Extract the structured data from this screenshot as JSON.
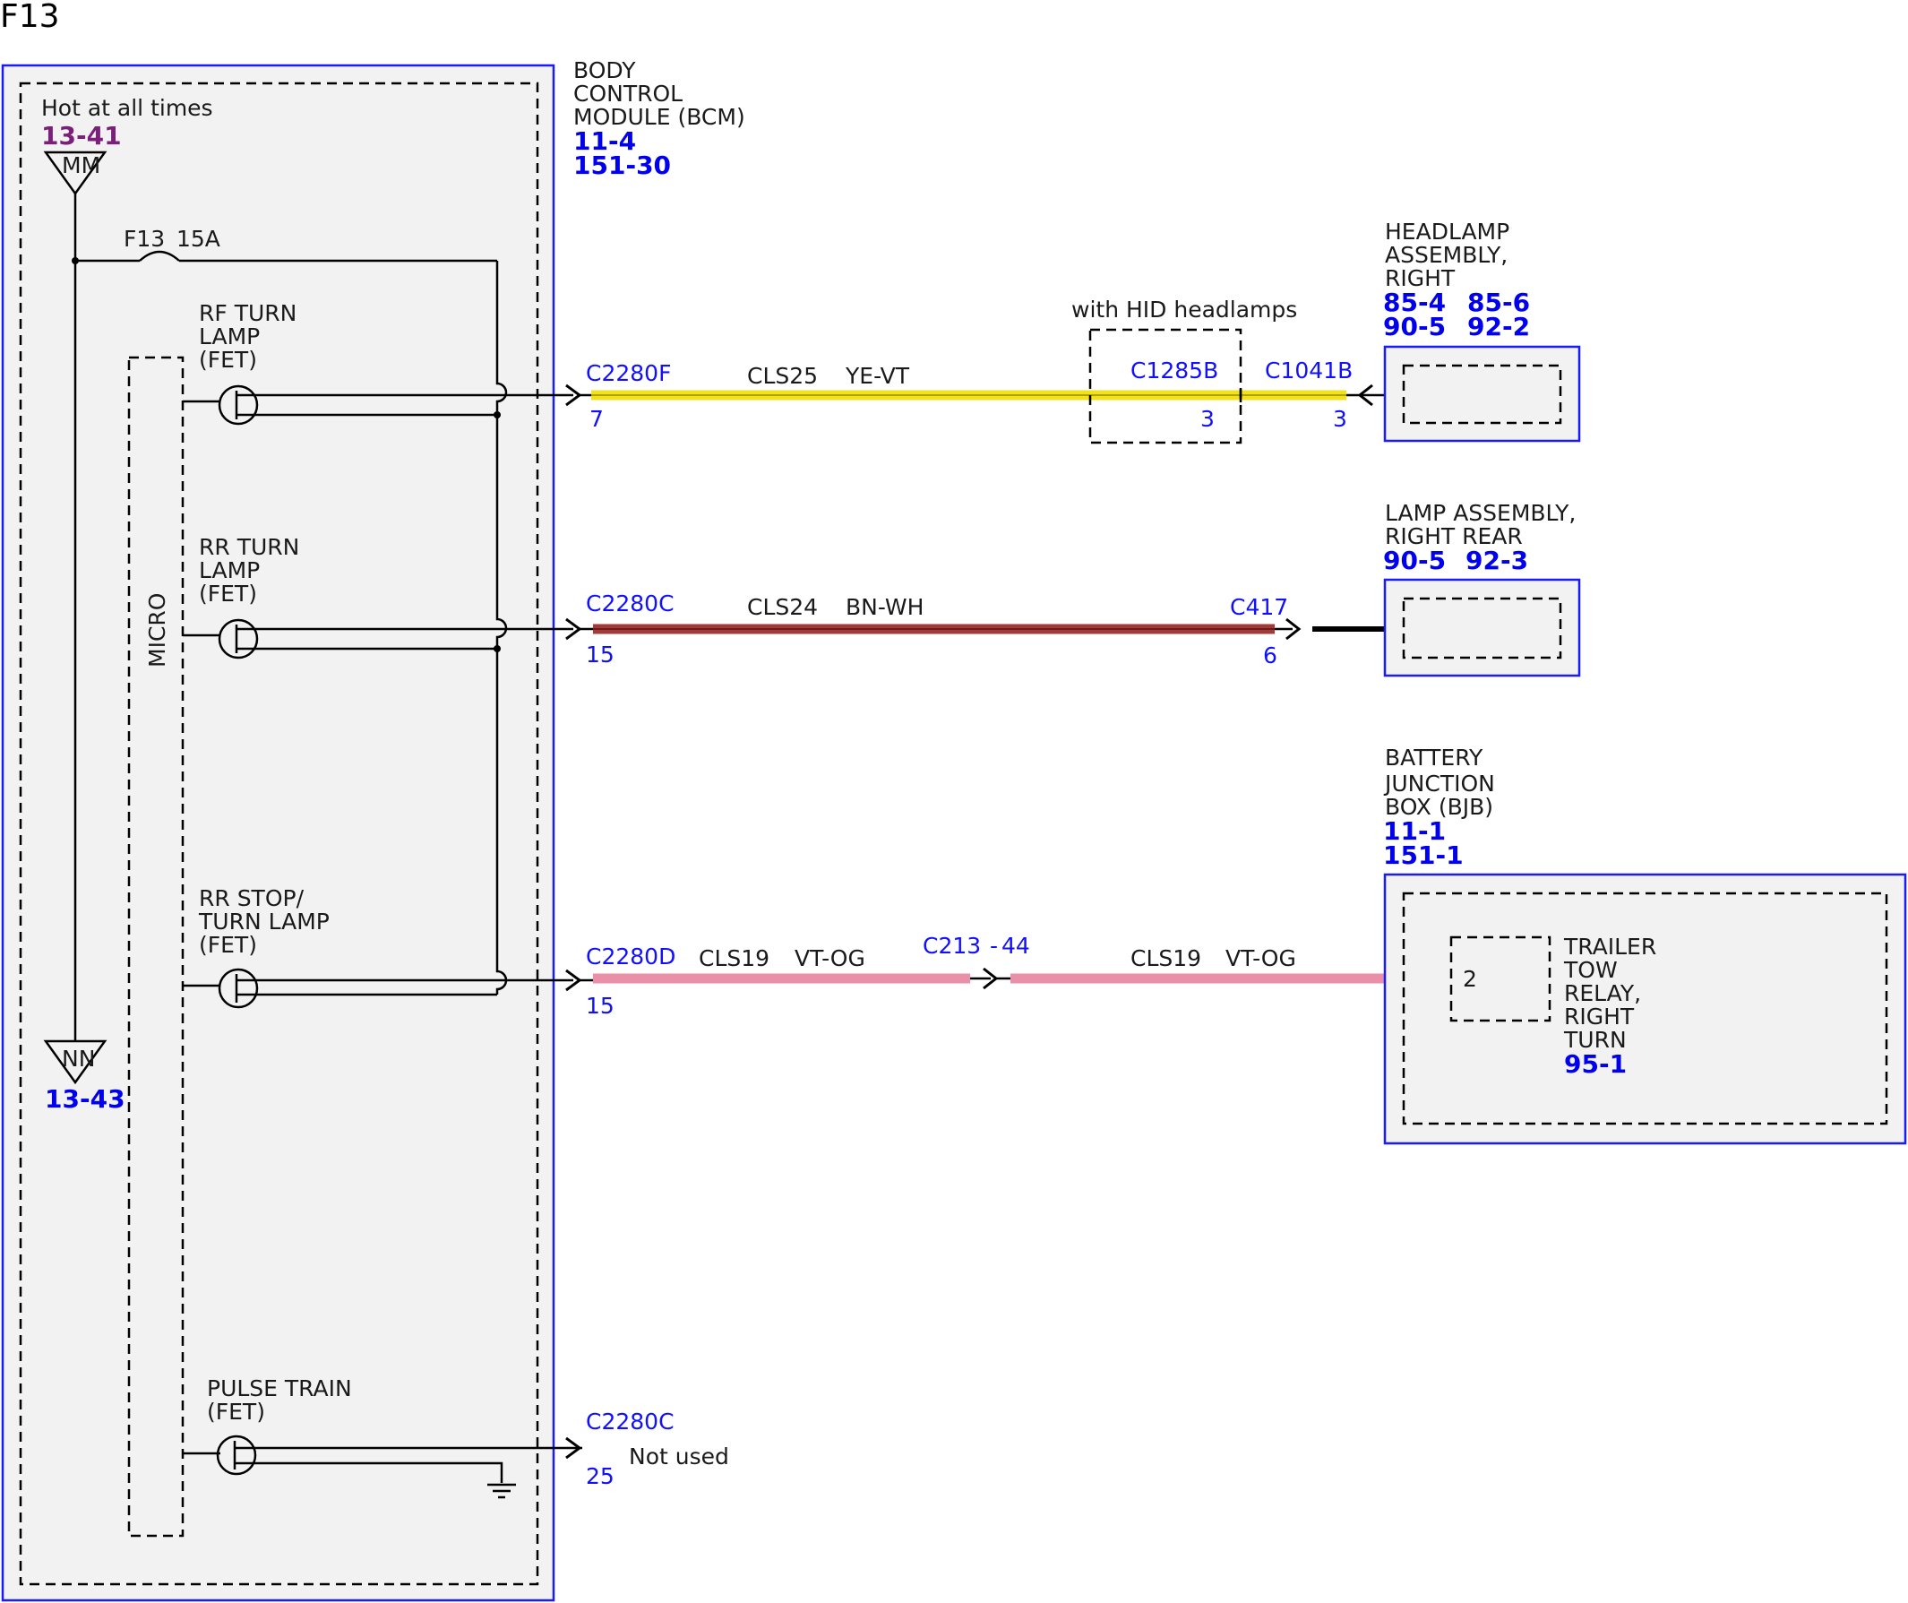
{
  "page_title": "F13",
  "bcm": {
    "name_lines": [
      "BODY",
      "CONTROL",
      "MODULE (BCM)"
    ],
    "refs": [
      "11-4",
      "151-30"
    ],
    "hot_label": "Hot at all times",
    "hot_ref": "13-41",
    "top_node": "MM",
    "bottom_node": "NN",
    "bottom_ref": "13-43",
    "fuse_label": "F13",
    "fuse_rating": "15A",
    "micro_label": "MICRO",
    "fet_rf_lines": [
      "RF TURN",
      "LAMP",
      "(FET)"
    ],
    "fet_rr_lines": [
      "RR TURN",
      "LAMP",
      "(FET)"
    ],
    "fet_stop_lines": [
      "RR STOP/",
      "TURN LAMP",
      "(FET)"
    ],
    "fet_pulse_lines": [
      "PULSE TRAIN",
      "(FET)"
    ]
  },
  "circuits": {
    "rf": {
      "connector": "C2280F",
      "pin": "7",
      "circuit": "CLS25",
      "color_code": "YE-VT",
      "wire_color": "#f2e21b",
      "inline_box_label": "with HID headlamps",
      "inline_connector": "C1285B",
      "inline_pin": "3",
      "end_connector": "C1041B",
      "end_pin": "3"
    },
    "rr": {
      "connector": "C2280C",
      "pin": "15",
      "circuit": "CLS24",
      "color_code": "BN-WH",
      "wire_color": "#a33a3a",
      "end_connector": "C417",
      "end_pin": "6"
    },
    "stop": {
      "connector": "C2280D",
      "pin": "15",
      "circuit": "CLS19",
      "color_code": "VT-OG",
      "wire_color": "#e98fa8",
      "mid_connector": "C213",
      "mid_pin": "44",
      "circuit_2": "CLS19",
      "color_code_2": "VT-OG"
    },
    "pulse": {
      "connector": "C2280C",
      "pin": "25",
      "note": "Not used"
    }
  },
  "components": {
    "headlamp": {
      "name_lines": [
        "HEADLAMP",
        "ASSEMBLY,",
        "RIGHT"
      ],
      "refs_row1": [
        "85-4",
        "85-6"
      ],
      "refs_row2": [
        "90-5",
        "92-2"
      ]
    },
    "rear_lamp": {
      "name_lines": [
        "LAMP ASSEMBLY,",
        "RIGHT REAR"
      ],
      "refs_row1": [
        "90-5",
        "92-3"
      ]
    },
    "bjb": {
      "name_lines": [
        "BATTERY",
        "JUNCTION",
        "BOX (BJB)"
      ],
      "refs": [
        "11-1",
        "151-1"
      ],
      "relay_pin": "2",
      "relay_lines": [
        "TRAILER",
        "TOW",
        "RELAY,",
        "RIGHT",
        "TURN"
      ],
      "relay_ref": "95-1"
    }
  }
}
